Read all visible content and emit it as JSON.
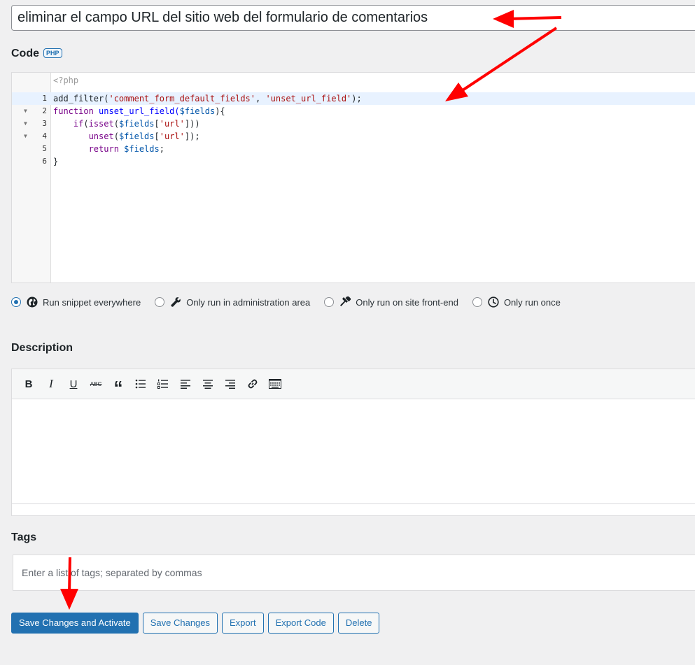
{
  "title_input": {
    "value": "eliminar el campo URL del sitio web del formulario de comentarios"
  },
  "code_section": {
    "title": "Code",
    "badge": "PHP",
    "php_open": "<?php",
    "lines": [
      {
        "num": "1",
        "fold": false
      },
      {
        "num": "2",
        "fold": true
      },
      {
        "num": "3",
        "fold": true
      },
      {
        "num": "4",
        "fold": true
      },
      {
        "num": "5",
        "fold": false
      },
      {
        "num": "6",
        "fold": false
      }
    ],
    "tokens": {
      "l1_fn": "add_filter(",
      "l1_s1": "'comment_form_default_fields'",
      "l1_sep": ", ",
      "l1_s2": "'unset_url_field'",
      "l1_end": ");",
      "l2_kw": "function",
      "l2_fn": " unset_url_field(",
      "l2_var": "$fields",
      "l2_end": "){",
      "l3_indent": "    ",
      "l3_kw": "if",
      "l3_open": "(",
      "l3_kw2": "isset",
      "l3_open2": "(",
      "l3_var": "$fields",
      "l3_br": "[",
      "l3_str": "'url'",
      "l3_end": "]))",
      "l4_indent": "       ",
      "l4_kw": "unset",
      "l4_open": "(",
      "l4_var": "$fields",
      "l4_br": "[",
      "l4_str": "'url'",
      "l4_end": "]);",
      "l5_indent": "       ",
      "l5_kw": "return",
      "l5_var": " $fields",
      "l5_end": ";",
      "l6": "}"
    }
  },
  "run_options": [
    {
      "label": "Run snippet everywhere",
      "checked": true,
      "icon": "globe-icon"
    },
    {
      "label": "Only run in administration area",
      "checked": false,
      "icon": "wrench-icon"
    },
    {
      "label": "Only run on site front-end",
      "checked": false,
      "icon": "hammer-icon"
    },
    {
      "label": "Only run once",
      "checked": false,
      "icon": "clock-icon"
    }
  ],
  "description": {
    "title": "Description"
  },
  "toolbar": {
    "bold": "B",
    "italic": "I",
    "underline": "U",
    "strike": "ABC",
    "quote": "“",
    "bullet_list": "bullet-list-icon",
    "numbered_list": "numbered-list-icon",
    "align_left": "align-left-icon",
    "align_center": "align-center-icon",
    "align_right": "align-right-icon",
    "link": "link-icon",
    "toolbar_toggle": "keyboard-icon"
  },
  "tags": {
    "title": "Tags",
    "placeholder": "Enter a list of tags; separated by commas"
  },
  "buttons": {
    "save_activate": "Save Changes and Activate",
    "save": "Save Changes",
    "export": "Export",
    "export_code": "Export Code",
    "delete": "Delete"
  },
  "colors": {
    "accent": "#2271b1",
    "annotation": "#ff0000"
  }
}
